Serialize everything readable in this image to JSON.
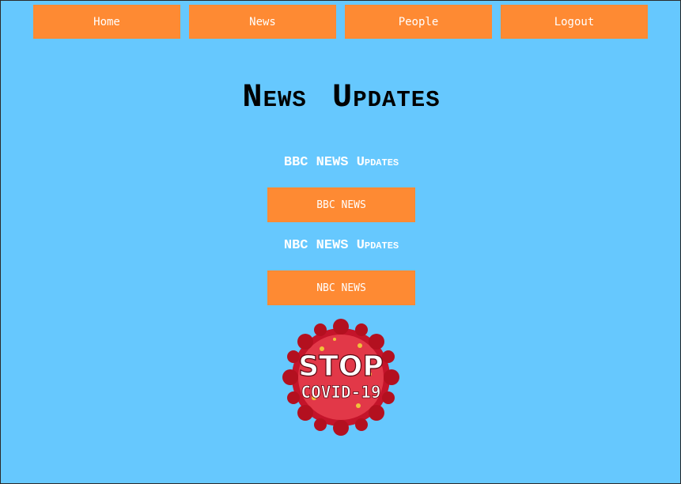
{
  "nav": {
    "items": [
      {
        "label": "Home",
        "name": "nav-home-button"
      },
      {
        "label": "News",
        "name": "nav-news-button"
      },
      {
        "label": "People",
        "name": "nav-people-button"
      },
      {
        "label": "Logout",
        "name": "nav-logout-button"
      }
    ]
  },
  "page": {
    "title": "News Updates"
  },
  "sections": [
    {
      "heading": "BBC NEWS Updates",
      "button_label": "BBC NEWS"
    },
    {
      "heading": "NBC NEWS Updates",
      "button_label": "NBC NEWS"
    }
  ],
  "image": {
    "line1": "STOP",
    "line2": "COVID-19"
  },
  "colors": {
    "background": "#66c8fe",
    "accent": "#fe8a33",
    "virus": "#d11b2b"
  }
}
